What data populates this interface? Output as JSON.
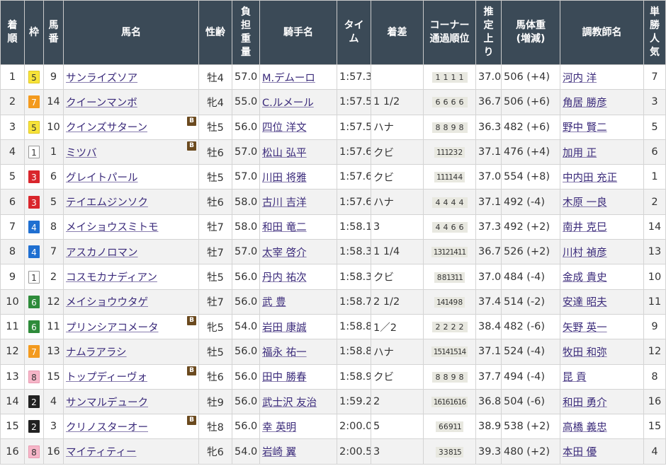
{
  "headers": {
    "finish": [
      "着",
      "順"
    ],
    "waku": [
      "枠"
    ],
    "umaban": [
      "馬",
      "番"
    ],
    "horse": [
      "馬名"
    ],
    "sexage": [
      "性齢"
    ],
    "weight": [
      "負",
      "担",
      "重",
      "量"
    ],
    "jockey": [
      "騎手名"
    ],
    "time": [
      "タイ",
      "ム"
    ],
    "margin": [
      "着差"
    ],
    "corner": [
      "コーナー",
      "通過順位"
    ],
    "last3f": [
      "推",
      "定",
      "上",
      "り"
    ],
    "bodyweight": [
      "馬体重",
      "(増減)"
    ],
    "trainer": [
      "調教師名"
    ],
    "pop": [
      "単",
      "勝",
      "人",
      "気"
    ]
  },
  "waku_colors": {
    "1": {
      "bg": "#ffffff",
      "fg": "#333333",
      "border": "#999999"
    },
    "2": {
      "bg": "#222222",
      "fg": "#ffffff",
      "border": "#222222"
    },
    "3": {
      "bg": "#d9262c",
      "fg": "#ffffff",
      "border": "#d9262c"
    },
    "4": {
      "bg": "#1f6fd1",
      "fg": "#ffffff",
      "border": "#1f6fd1"
    },
    "5": {
      "bg": "#f7e33a",
      "fg": "#333333",
      "border": "#e0c820"
    },
    "6": {
      "bg": "#2e8b3a",
      "fg": "#ffffff",
      "border": "#2e8b3a"
    },
    "7": {
      "bg": "#f39a1e",
      "fg": "#ffffff",
      "border": "#f39a1e"
    },
    "8": {
      "bg": "#f6b6c8",
      "fg": "#333333",
      "border": "#e99ab1"
    }
  },
  "blinker_label": "B",
  "rows": [
    {
      "finish": "1",
      "waku": "5",
      "umaban": "9",
      "horse": "サンライズソア",
      "blinker": false,
      "sexage": "牡4",
      "weight": "57.0",
      "jockey": "M.デムーロ",
      "time": "1:57.3",
      "margin": "",
      "corner": [
        "1",
        "1",
        "1",
        "1"
      ],
      "last3f": "37.0",
      "bodyweight": "506 (+4)",
      "trainer": "河内 洋",
      "pop": "7"
    },
    {
      "finish": "2",
      "waku": "7",
      "umaban": "14",
      "horse": "クイーンマンボ",
      "blinker": false,
      "sexage": "牝4",
      "weight": "55.0",
      "jockey": "C.ルメール",
      "time": "1:57.5",
      "margin": "1 1/2",
      "corner": [
        "6",
        "6",
        "6",
        "6"
      ],
      "last3f": "36.7",
      "bodyweight": "506 (+6)",
      "trainer": "角居 勝彦",
      "pop": "3"
    },
    {
      "finish": "3",
      "waku": "5",
      "umaban": "10",
      "horse": "クインズサターン",
      "blinker": true,
      "sexage": "牡5",
      "weight": "56.0",
      "jockey": "四位 洋文",
      "time": "1:57.5",
      "margin": "ハナ",
      "corner": [
        "8",
        "8",
        "9",
        "8"
      ],
      "last3f": "36.3",
      "bodyweight": "482 (+6)",
      "trainer": "野中 賢二",
      "pop": "5"
    },
    {
      "finish": "4",
      "waku": "1",
      "umaban": "1",
      "horse": "ミツバ",
      "blinker": true,
      "sexage": "牡6",
      "weight": "57.0",
      "jockey": "松山 弘平",
      "time": "1:57.6",
      "margin": "クビ",
      "corner": [
        "11",
        "12",
        "3",
        "2"
      ],
      "last3f": "37.1",
      "bodyweight": "476 (+4)",
      "trainer": "加用 正",
      "pop": "6"
    },
    {
      "finish": "5",
      "waku": "3",
      "umaban": "6",
      "horse": "グレイトパール",
      "blinker": false,
      "sexage": "牡5",
      "weight": "57.0",
      "jockey": "川田 将雅",
      "time": "1:57.6",
      "margin": "クビ",
      "corner": [
        "11",
        "11",
        "4",
        "4"
      ],
      "last3f": "37.0",
      "bodyweight": "554 (+8)",
      "trainer": "中内田 充正",
      "pop": "1"
    },
    {
      "finish": "6",
      "waku": "3",
      "umaban": "5",
      "horse": "テイエムジンソク",
      "blinker": false,
      "sexage": "牡6",
      "weight": "58.0",
      "jockey": "古川 吉洋",
      "time": "1:57.6",
      "margin": "ハナ",
      "corner": [
        "4",
        "4",
        "4",
        "4"
      ],
      "last3f": "37.1",
      "bodyweight": "492 (-4)",
      "trainer": "木原 一良",
      "pop": "2"
    },
    {
      "finish": "7",
      "waku": "4",
      "umaban": "8",
      "horse": "メイショウスミトモ",
      "blinker": false,
      "sexage": "牡7",
      "weight": "58.0",
      "jockey": "和田 竜二",
      "time": "1:58.1",
      "margin": "3",
      "corner": [
        "4",
        "4",
        "6",
        "6"
      ],
      "last3f": "37.3",
      "bodyweight": "492 (+2)",
      "trainer": "南井 克巳",
      "pop": "14"
    },
    {
      "finish": "8",
      "waku": "4",
      "umaban": "7",
      "horse": "アスカノロマン",
      "blinker": false,
      "sexage": "牡7",
      "weight": "57.0",
      "jockey": "太宰 啓介",
      "time": "1:58.3",
      "margin": "1 1/4",
      "corner": [
        "13",
        "12",
        "14",
        "11"
      ],
      "last3f": "36.7",
      "bodyweight": "526 (+2)",
      "trainer": "川村 禎彦",
      "pop": "13"
    },
    {
      "finish": "9",
      "waku": "1",
      "umaban": "2",
      "horse": "コスモカナディアン",
      "blinker": false,
      "sexage": "牡5",
      "weight": "56.0",
      "jockey": "丹内 祐次",
      "time": "1:58.3",
      "margin": "クビ",
      "corner": [
        "8",
        "8",
        "13",
        "11"
      ],
      "last3f": "37.0",
      "bodyweight": "484 (-4)",
      "trainer": "金成 貴史",
      "pop": "10"
    },
    {
      "finish": "10",
      "waku": "6",
      "umaban": "12",
      "horse": "メイショウウタゲ",
      "blinker": false,
      "sexage": "牡7",
      "weight": "56.0",
      "jockey": "武 豊",
      "time": "1:58.7",
      "margin": "2 1/2",
      "corner": [
        "14",
        "14",
        "9",
        "8"
      ],
      "last3f": "37.4",
      "bodyweight": "514 (-2)",
      "trainer": "安達 昭夫",
      "pop": "11"
    },
    {
      "finish": "11",
      "waku": "6",
      "umaban": "11",
      "horse": "プリンシアコメータ",
      "blinker": true,
      "sexage": "牝5",
      "weight": "54.0",
      "jockey": "岩田 康誠",
      "time": "1:58.8",
      "margin": "1／2",
      "corner": [
        "2",
        "2",
        "2",
        "2"
      ],
      "last3f": "38.4",
      "bodyweight": "482 (-6)",
      "trainer": "矢野 英一",
      "pop": "9"
    },
    {
      "finish": "12",
      "waku": "7",
      "umaban": "13",
      "horse": "ナムラアラシ",
      "blinker": false,
      "sexage": "牡5",
      "weight": "56.0",
      "jockey": "福永 祐一",
      "time": "1:58.8",
      "margin": "ハナ",
      "corner": [
        "15",
        "14",
        "15",
        "14"
      ],
      "last3f": "37.1",
      "bodyweight": "524 (-4)",
      "trainer": "牧田 和弥",
      "pop": "12"
    },
    {
      "finish": "13",
      "waku": "8",
      "umaban": "15",
      "horse": "トップディーヴォ",
      "blinker": true,
      "sexage": "牡6",
      "weight": "56.0",
      "jockey": "田中 勝春",
      "time": "1:58.9",
      "margin": "クビ",
      "corner": [
        "8",
        "8",
        "9",
        "8"
      ],
      "last3f": "37.7",
      "bodyweight": "494 (-4)",
      "trainer": "昆 貢",
      "pop": "8"
    },
    {
      "finish": "14",
      "waku": "2",
      "umaban": "4",
      "horse": "サンマルデューク",
      "blinker": false,
      "sexage": "牡9",
      "weight": "56.0",
      "jockey": "武士沢 友治",
      "time": "1:59.2",
      "margin": "2",
      "corner": [
        "16",
        "16",
        "16",
        "16"
      ],
      "last3f": "36.8",
      "bodyweight": "504 (-6)",
      "trainer": "和田 勇介",
      "pop": "16"
    },
    {
      "finish": "15",
      "waku": "2",
      "umaban": "3",
      "horse": "クリノスターオー",
      "blinker": true,
      "sexage": "牡8",
      "weight": "56.0",
      "jockey": "幸 英明",
      "time": "2:00.0",
      "margin": "5",
      "corner": [
        "6",
        "6",
        "9",
        "11"
      ],
      "last3f": "38.9",
      "bodyweight": "538 (+2)",
      "trainer": "高橋 義忠",
      "pop": "15"
    },
    {
      "finish": "16",
      "waku": "8",
      "umaban": "16",
      "horse": "マイティティー",
      "blinker": false,
      "sexage": "牝6",
      "weight": "54.0",
      "jockey": "岩崎 翼",
      "time": "2:00.5",
      "margin": "3",
      "corner": [
        "3",
        "3",
        "8",
        "15"
      ],
      "last3f": "39.3",
      "bodyweight": "480 (+2)",
      "trainer": "本田 優",
      "pop": "4"
    }
  ]
}
